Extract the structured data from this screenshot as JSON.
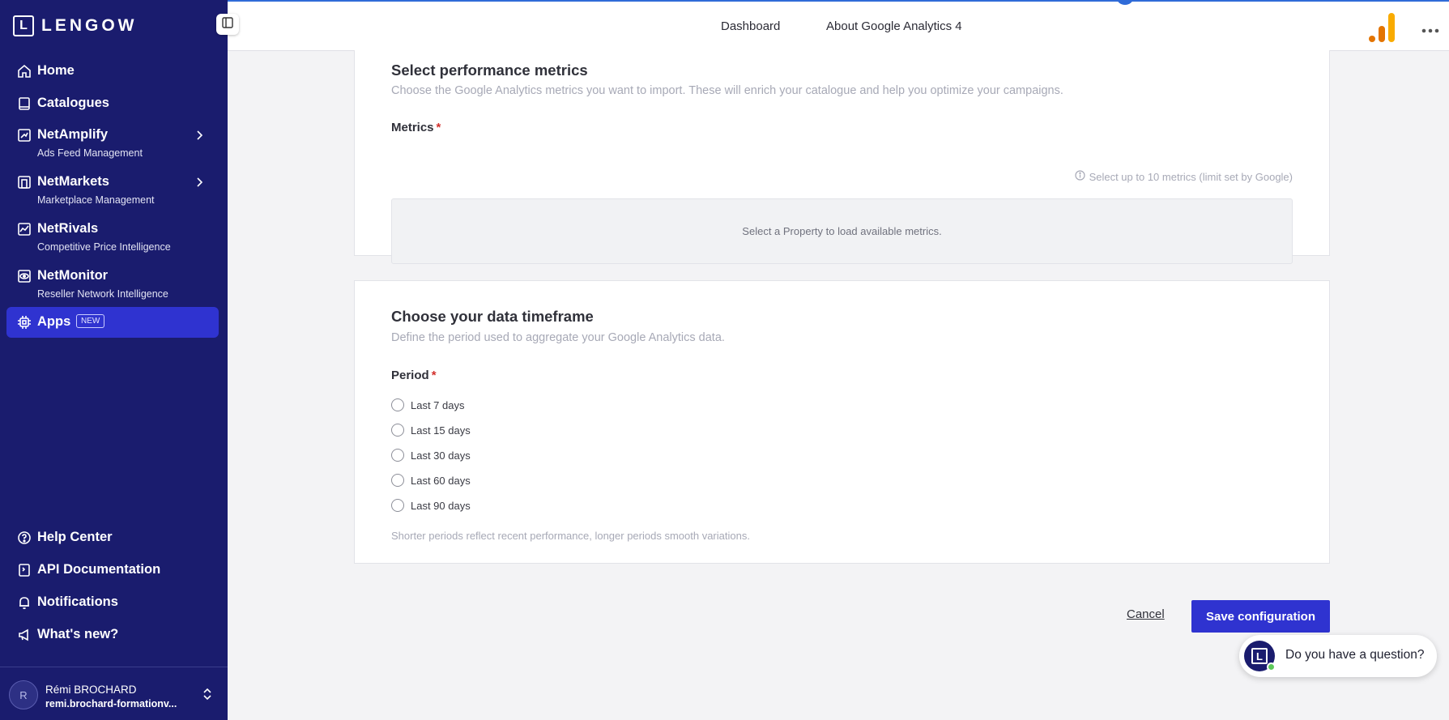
{
  "brand": {
    "logo_letter": "L",
    "name": "LENGOW"
  },
  "sidebar": {
    "items": [
      {
        "label": "Home",
        "icon": "home-icon"
      },
      {
        "label": "Catalogues",
        "icon": "book-icon"
      },
      {
        "label": "NetAmplify",
        "sub": "Ads Feed Management",
        "icon": "amplify-icon"
      },
      {
        "label": "NetMarkets",
        "sub": "Marketplace Management",
        "icon": "store-icon"
      },
      {
        "label": "NetRivals",
        "sub": "Competitive Price Intelligence",
        "icon": "chart-line-icon"
      },
      {
        "label": "NetMonitor",
        "sub": "Reseller Network Intelligence",
        "icon": "eye-icon"
      },
      {
        "label": "Apps",
        "badge": "NEW",
        "icon": "chip-icon",
        "active": true
      }
    ],
    "bottom_items": [
      {
        "label": "Help Center",
        "icon": "help-icon"
      },
      {
        "label": "API Documentation",
        "icon": "book-code-icon"
      },
      {
        "label": "Notifications",
        "icon": "bell-icon"
      },
      {
        "label": "What's new?",
        "icon": "megaphone-icon"
      }
    ],
    "user": {
      "initial": "R",
      "name": "Rémi BROCHARD",
      "email": "remi.brochard-formationv..."
    }
  },
  "topbar": {
    "tabs": [
      "Dashboard",
      "About Google Analytics 4"
    ]
  },
  "metrics_card": {
    "title": "Select performance metrics",
    "description": "Choose the Google Analytics metrics you want to import. These will enrich your catalogue and help you optimize your campaigns.",
    "field_label": "Metrics",
    "required": "*",
    "hint": "Select up to 10 metrics (limit set by Google)",
    "placeholder": "Select a Property to load available metrics."
  },
  "timeframe_card": {
    "title": "Choose your data timeframe",
    "description": "Define the period used to aggregate your Google Analytics data.",
    "field_label": "Period",
    "required": "*",
    "options": [
      "Last 7 days",
      "Last 15 days",
      "Last 30 days",
      "Last 60 days",
      "Last 90 days"
    ],
    "note": "Shorter periods reflect recent performance, longer periods smooth variations."
  },
  "actions": {
    "cancel": "Cancel",
    "save": "Save configuration"
  },
  "chat": {
    "text": "Do you have a question?"
  },
  "colors": {
    "sidebar": "#1a1c6e",
    "accent": "#2f33d0",
    "required": "#d2302c",
    "ga_orange": "#f9ab00",
    "ga_dark_orange": "#e37400"
  }
}
